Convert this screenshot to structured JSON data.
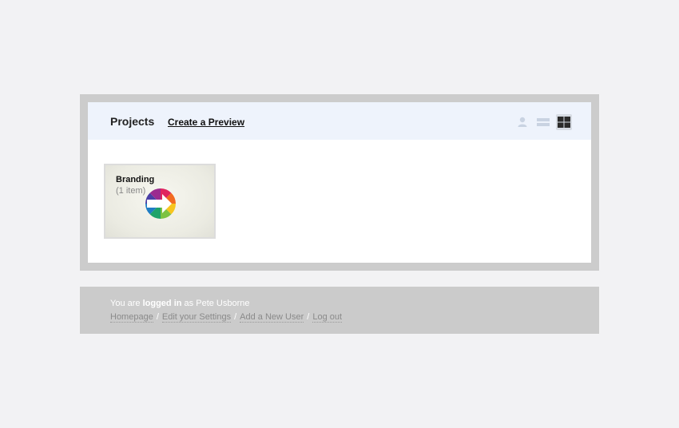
{
  "header": {
    "title": "Projects",
    "create_link": "Create a Preview",
    "view_icons": [
      "user-view-icon",
      "list-view-icon",
      "grid-view-icon"
    ],
    "active_view": "grid-view-icon"
  },
  "projects": [
    {
      "name": "Branding",
      "count": "(1 item)",
      "thumbnail_icon": "rainbow-arrow-logo-icon"
    }
  ],
  "footer": {
    "prefix": "You are",
    "logged_in": "logged in",
    "as": "as",
    "user_name": "Pete Usborne",
    "links": [
      "Homepage",
      "Edit your Settings",
      "Add a New User",
      "Log out"
    ],
    "separator": "/"
  },
  "colors": {
    "page_bg": "#f2f2f4",
    "frame": "#cccccc",
    "header_bg": "#eef3fc",
    "footer_bg": "#cbcbcb"
  }
}
